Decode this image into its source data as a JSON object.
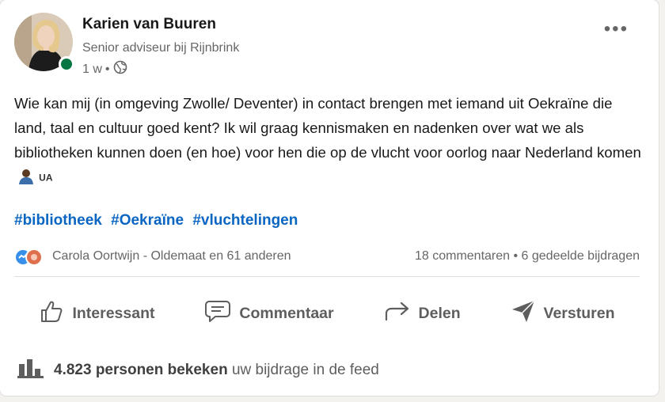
{
  "author": {
    "name": "Karien van Buuren",
    "headline": "Senior adviseur bij Rijnbrink",
    "time": "1 w",
    "visibility_icon": "globe-icon"
  },
  "post": {
    "text": "Wie kan mij (in omgeving Zwolle/ Deventer) in contact brengen met iemand uit Oekraïne die land, taal en cultuur goed kent? Ik wil graag kennismaken en nadenken over wat we als bibliotheken kunnen doen (en hoe) voor hen die op de vlucht voor oorlog naar Nederland komen",
    "flag_text": "UA",
    "hashtags": [
      "#bibliotheek",
      "#Oekraïne",
      "#vluchtelingen"
    ]
  },
  "social": {
    "reactors": "Carola Oortwijn - Oldemaat en 61 anderen",
    "counts": "18 commentaren • 6 gedeelde bijdragen"
  },
  "actions": {
    "like": "Interessant",
    "comment": "Commentaar",
    "share": "Delen",
    "send": "Versturen"
  },
  "analytics": {
    "count": "4.823 personen bekeken",
    "suffix": "uw bijdrage in de feed"
  },
  "colors": {
    "link": "#0a66c2",
    "presence": "#057642"
  }
}
